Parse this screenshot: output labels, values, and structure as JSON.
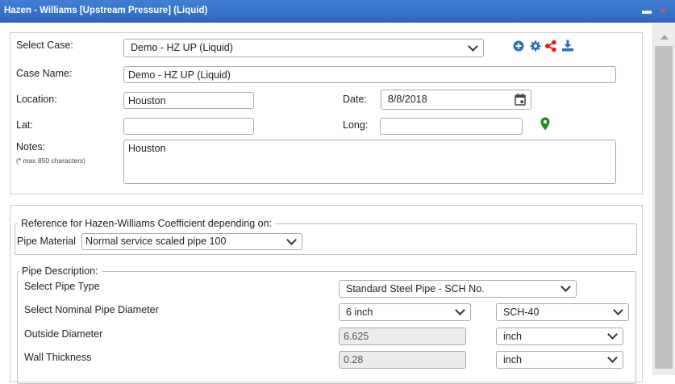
{
  "window": {
    "title": "Hazen - Williams [Upstream Pressure] (Liquid)",
    "minimize_glyph": "▬",
    "close_glyph": "×"
  },
  "colors": {
    "titlebar": "#2d69c0",
    "icon_blue": "#2a6ebb",
    "share_red": "#e02020",
    "pin_green": "#1e8e1e"
  },
  "case": {
    "select_label": "Select Case:",
    "selected_case": "Demo - HZ UP (Liquid)",
    "name_label": "Case Name:",
    "name_value": "Demo - HZ UP (Liquid)",
    "location_label": "Location:",
    "location_value": "Houston",
    "date_label": "Date:",
    "date_value": "8/8/2018",
    "lat_label": "Lat:",
    "lat_value": "",
    "long_label": "Long:",
    "long_value": "",
    "notes_label": "Notes:",
    "notes_hint": "(* max 850 characters)",
    "notes_value": "Houston",
    "toolbar_icons": [
      "add-circle-icon",
      "gear-icon",
      "share-icon",
      "download-icon"
    ]
  },
  "reference": {
    "legend": "Reference for Hazen-Williams Coefficient depending on:",
    "pipe_material_label": "Pipe Material",
    "pipe_material_value": "Normal service scaled pipe 100"
  },
  "pipe": {
    "legend": "Pipe Description:",
    "type_label": "Select Pipe Type",
    "type_value": "Standard Steel Pipe - SCH No.",
    "diameter_label": "Select Nominal Pipe Diameter",
    "diameter_value": "6 inch",
    "schedule_value": "SCH-40",
    "od_label": "Outside Diameter",
    "od_value": "6.625",
    "od_unit": "inch",
    "wall_label": "Wall Thickness",
    "wall_value": "0.28",
    "wall_unit": "inch"
  }
}
